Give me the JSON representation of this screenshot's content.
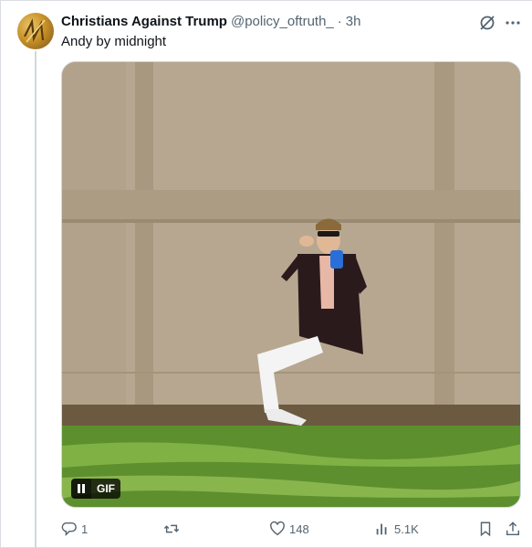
{
  "tweet": {
    "display_name": "Christians Against Trump",
    "handle": "@policy_oftruth_",
    "separator": "·",
    "time": "3h",
    "text": "Andy by midnight"
  },
  "media": {
    "badge_label": "GIF",
    "badge_icon": "pause-icon"
  },
  "actions": {
    "reply_count": "1",
    "repost_count": "",
    "like_count": "148",
    "views_count": "5.1K"
  },
  "icons": {
    "header": [
      "grok-icon",
      "more-icon"
    ],
    "actions": [
      "reply-icon",
      "repost-icon",
      "like-icon",
      "views-icon",
      "bookmark-icon",
      "share-icon"
    ]
  },
  "colors": {
    "text_primary": "#0f1419",
    "text_secondary": "#536471",
    "border": "#cfd9de"
  }
}
